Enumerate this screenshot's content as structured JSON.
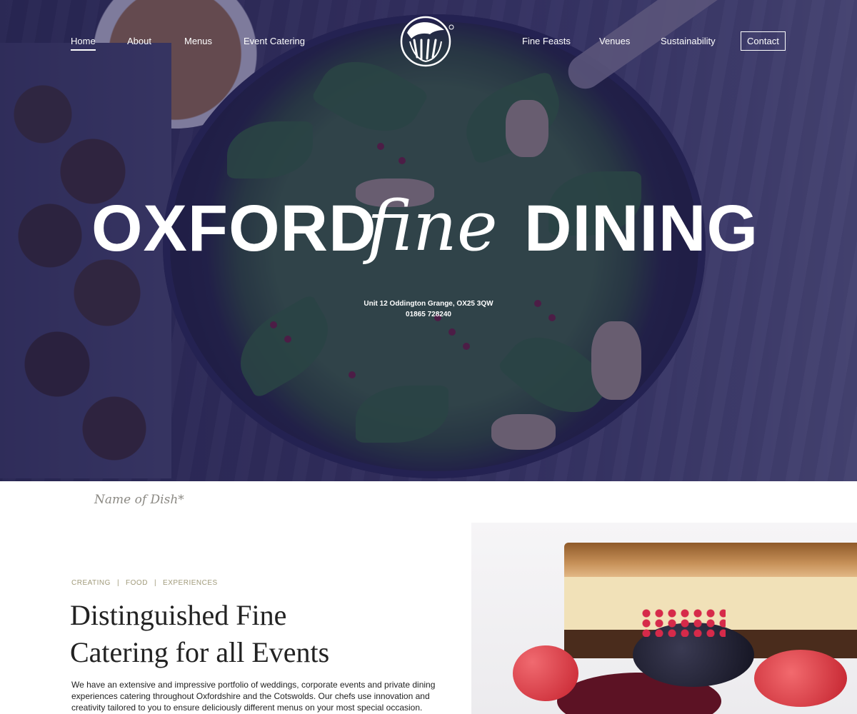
{
  "nav": {
    "left": [
      "Home",
      "About",
      "Menus",
      "Event Catering"
    ],
    "right": [
      "Fine Feasts",
      "Venues",
      "Sustainability"
    ],
    "contact": "Contact",
    "active": "Home"
  },
  "logo": {
    "icon": "chef-hand-logo-icon"
  },
  "hero": {
    "title_word1": "OXFORD",
    "title_word2": "fine",
    "title_word3": "DINING",
    "address_line": "Unit 12 Oddington Grange, OX25 3QW",
    "phone": "01865 728240"
  },
  "dish_caption": "Name of Dish*",
  "intro": {
    "eyebrow": [
      "CREATING",
      "FOOD",
      "EXPERIENCES"
    ],
    "eyebrow_sep": "|",
    "heading_line1": "Distinguished Fine",
    "heading_line2": "Catering for all Events",
    "body_line1": "We have an extensive and impressive portfolio of weddings, corporate events and private dining",
    "body_line2": "experiences catering throughout Oxfordshire and the Cotswolds. Our chefs use innovation and",
    "body_line3": "creativity tailored to you to ensure deliciously different menus on your most special occasion."
  },
  "colors": {
    "overlay": "#26225a",
    "accent_text": "#a09a7a",
    "heading": "#222222"
  }
}
